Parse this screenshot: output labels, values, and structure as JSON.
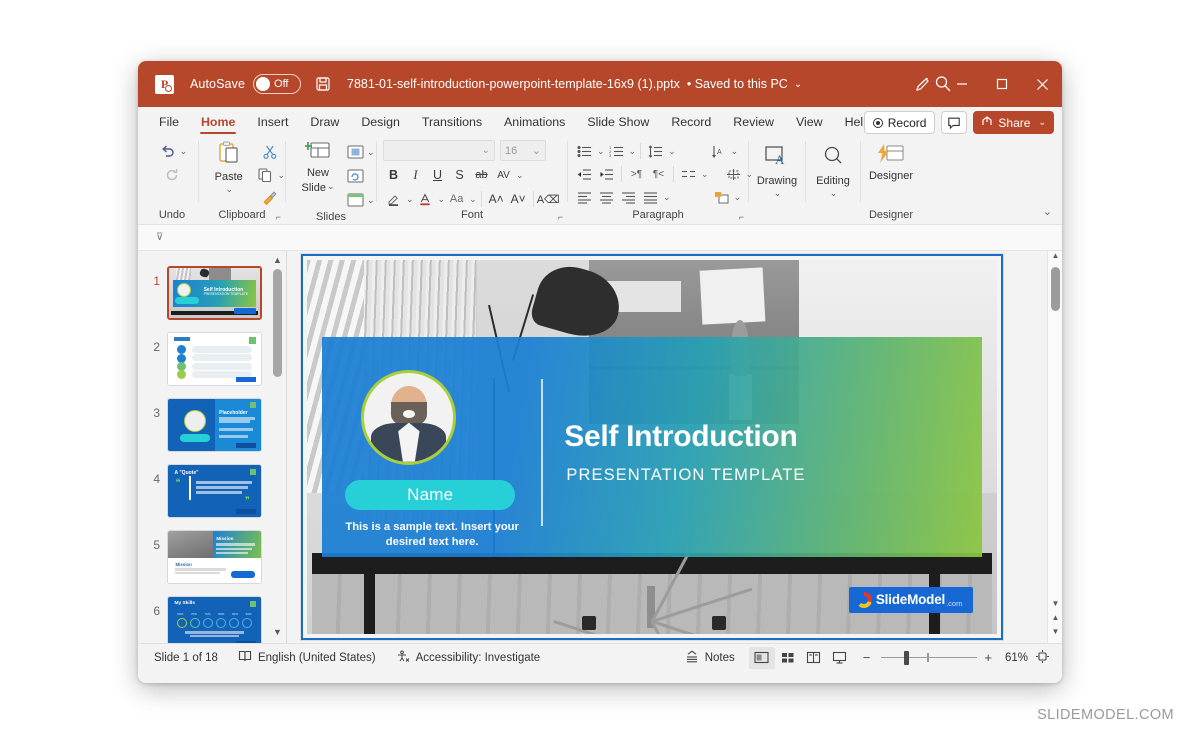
{
  "titlebar": {
    "app_icon": "powerpoint-icon",
    "autosave_label": "AutoSave",
    "autosave_state": "Off",
    "save_icon": "save-icon",
    "document_title": "7881-01-self-introduction-powerpoint-template-16x9 (1).pptx",
    "separator": "•",
    "save_status": "Saved to this PC",
    "title_chevron": "⌄",
    "search_icon": "search-icon",
    "pen_icon": "pen-icon",
    "minimize_icon": "minimize-icon",
    "maximize_icon": "maximize-icon",
    "close_icon": "close-icon"
  },
  "ribbon_tabs": {
    "items": [
      {
        "label": "File",
        "active": false
      },
      {
        "label": "Home",
        "active": true
      },
      {
        "label": "Insert",
        "active": false
      },
      {
        "label": "Draw",
        "active": false
      },
      {
        "label": "Design",
        "active": false
      },
      {
        "label": "Transitions",
        "active": false
      },
      {
        "label": "Animations",
        "active": false
      },
      {
        "label": "Slide Show",
        "active": false
      },
      {
        "label": "Record",
        "active": false
      },
      {
        "label": "Review",
        "active": false
      },
      {
        "label": "View",
        "active": false
      },
      {
        "label": "Help",
        "active": false
      }
    ],
    "record_button": "Record",
    "comment_icon": "comment-icon",
    "share_button": "Share",
    "share_chevron": "⌄",
    "collapse_icon": "collapse-ribbon-icon"
  },
  "ribbon": {
    "groups": [
      {
        "name": "Undo",
        "label": "Undo"
      },
      {
        "name": "Clipboard",
        "label": "Clipboard",
        "paste_label": "Paste",
        "dialog_launcher": "⌐"
      },
      {
        "name": "Slides",
        "label": "Slides",
        "new_slide_label": "New\nSlide",
        "new_slide_line1": "New",
        "new_slide_line2": "Slide"
      },
      {
        "name": "Font",
        "label": "Font",
        "font_name_value": "",
        "font_size_value": "16",
        "dialog_launcher": "⌐"
      },
      {
        "name": "Paragraph",
        "label": "Paragraph",
        "dialog_launcher": "⌐"
      },
      {
        "name": "Drawing",
        "label": "",
        "button_label": "Drawing"
      },
      {
        "name": "Editing",
        "label": "",
        "button_label": "Editing"
      },
      {
        "name": "Designer",
        "label": "Designer",
        "button_label": "Designer"
      }
    ],
    "font_buttons": [
      "B",
      "I",
      "U",
      "S",
      "ab",
      "AV"
    ],
    "expand_icon": "expand-ribbon-icon"
  },
  "thumbnails": {
    "slides": [
      {
        "number": "1",
        "selected": true
      },
      {
        "number": "2",
        "selected": false
      },
      {
        "number": "3",
        "selected": false
      },
      {
        "number": "4",
        "selected": false
      },
      {
        "number": "5",
        "selected": false
      },
      {
        "number": "6",
        "selected": false
      }
    ],
    "scroll_up_icon": "scroll-up-icon",
    "scroll_down_icon": "scroll-down-icon"
  },
  "slide": {
    "title": "Self Introduction",
    "subtitle": "PRESENTATION TEMPLATE",
    "name_pill": "Name",
    "sample_text": "This is a sample text. Insert your desired text here.",
    "logo_text": "SlideModel",
    "logo_suffix": ".com",
    "accent_gradient_start": "#1b7fd4",
    "accent_gradient_end": "#8cc63f",
    "pill_color": "#27cfd6",
    "avatar_ring_color": "#a9cf3a"
  },
  "canvas_scroll": {
    "up_icon": "scroll-up-icon",
    "down_icon": "scroll-down-icon",
    "prev_slide_icon": "previous-slide-icon",
    "next_slide_icon": "next-slide-icon"
  },
  "statusbar": {
    "slide_counter": "Slide 1 of 18",
    "language_icon": "language-book-icon",
    "language": "English (United States)",
    "accessibility_icon": "accessibility-icon",
    "accessibility": "Accessibility: Investigate",
    "notes_label": "Notes",
    "notes_icon": "notes-icon",
    "view_normal_icon": "normal-view-icon",
    "view_sorter_icon": "slide-sorter-icon",
    "view_reading_icon": "reading-view-icon",
    "view_slideshow_icon": "slideshow-icon",
    "zoom_out_icon": "−",
    "zoom_in_icon": "+",
    "zoom_level": "61%",
    "fit_slide_icon": "fit-to-window-icon"
  },
  "watermark": "SLIDEMODEL.COM"
}
